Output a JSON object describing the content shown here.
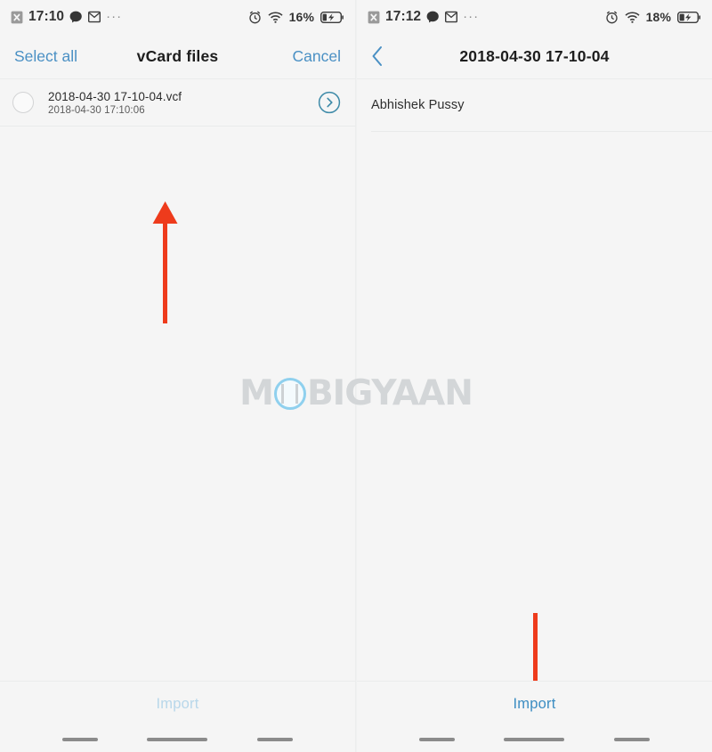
{
  "colors": {
    "accent_blue": "#3c8dc2",
    "accent_blue_disabled": "#b8d7ea",
    "chevron_teal": "#3e8aa8",
    "arrow_red": "#ee3b1c",
    "page_bg": "#f5f5f5",
    "separator": "#e9eaea",
    "watermark_gray": "#d3d6d8",
    "watermark_blue": "#8fd0ee"
  },
  "watermark": {
    "text_before": "M",
    "text_after": "BIGYAAN",
    "full_text": "MOBIGYAAN"
  },
  "left_panel": {
    "statusbar": {
      "time": "17:10",
      "battery_percent": "16%",
      "icons_left": [
        "app-x-icon",
        "chat-bubble-icon",
        "mail-icon",
        "more-dots-icon"
      ],
      "icons_right": [
        "alarm-icon",
        "wifi-icon",
        "battery-charging-icon"
      ],
      "overflow_dots": "···"
    },
    "appbar": {
      "select_all_label": "Select all",
      "title": "vCard files",
      "cancel_label": "Cancel"
    },
    "files": [
      {
        "name": "2018-04-30 17-10-04.vcf",
        "date": "2018-04-30 17:10:06",
        "checked": false,
        "detail_icon": "chevron-right-circle-icon"
      }
    ],
    "bottom": {
      "import_label": "Import",
      "import_enabled": false
    },
    "annotation": {
      "arrow_direction": "up"
    }
  },
  "right_panel": {
    "statusbar": {
      "time": "17:12",
      "battery_percent": "18%",
      "icons_left": [
        "app-x-icon",
        "chat-bubble-icon",
        "mail-icon",
        "more-dots-icon"
      ],
      "icons_right": [
        "alarm-icon",
        "wifi-icon",
        "battery-charging-icon"
      ],
      "overflow_dots": "···"
    },
    "appbar": {
      "back_icon": "chevron-left-icon",
      "title": "2018-04-30 17-10-04"
    },
    "contacts": [
      {
        "name": "Abhishek Pussy"
      }
    ],
    "bottom": {
      "import_label": "Import",
      "import_enabled": true
    },
    "annotation": {
      "arrow_direction": "down"
    }
  },
  "navbar": {
    "dashes": [
      "back-dash",
      "home-dash",
      "recents-dash"
    ]
  }
}
